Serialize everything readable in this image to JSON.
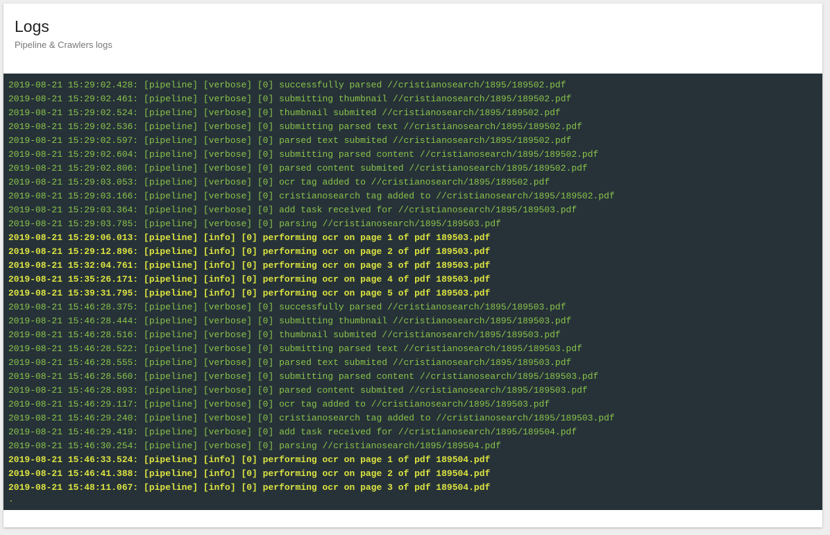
{
  "header": {
    "title": "Logs",
    "subtitle": "Pipeline & Crawlers logs"
  },
  "colors": {
    "console_bg": "#263238",
    "verbose_text": "#8bc34a",
    "info_text": "#dce340"
  },
  "logs": [
    {
      "level": "verbose",
      "text": "2019-08-21 15:29:02.428: [pipeline] [verbose] [0] successfully parsed //cristianosearch/1895/189502.pdf"
    },
    {
      "level": "verbose",
      "text": "2019-08-21 15:29:02.461: [pipeline] [verbose] [0] submitting thumbnail //cristianosearch/1895/189502.pdf"
    },
    {
      "level": "verbose",
      "text": "2019-08-21 15:29:02.524: [pipeline] [verbose] [0] thumbnail submited //cristianosearch/1895/189502.pdf"
    },
    {
      "level": "verbose",
      "text": "2019-08-21 15:29:02.536: [pipeline] [verbose] [0] submitting parsed text //cristianosearch/1895/189502.pdf"
    },
    {
      "level": "verbose",
      "text": "2019-08-21 15:29:02.597: [pipeline] [verbose] [0] parsed text submited //cristianosearch/1895/189502.pdf"
    },
    {
      "level": "verbose",
      "text": "2019-08-21 15:29:02.604: [pipeline] [verbose] [0] submitting parsed content //cristianosearch/1895/189502.pdf"
    },
    {
      "level": "verbose",
      "text": "2019-08-21 15:29:02.806: [pipeline] [verbose] [0] parsed content submited //cristianosearch/1895/189502.pdf"
    },
    {
      "level": "verbose",
      "text": "2019-08-21 15:29:03.053: [pipeline] [verbose] [0] ocr tag added to //cristianosearch/1895/189502.pdf"
    },
    {
      "level": "verbose",
      "text": "2019-08-21 15:29:03.166: [pipeline] [verbose] [0] cristianosearch tag added to //cristianosearch/1895/189502.pdf"
    },
    {
      "level": "verbose",
      "text": "2019-08-21 15:29:03.364: [pipeline] [verbose] [0] add task received for //cristianosearch/1895/189503.pdf"
    },
    {
      "level": "verbose",
      "text": "2019-08-21 15:29:03.785: [pipeline] [verbose] [0] parsing //cristianosearch/1895/189503.pdf"
    },
    {
      "level": "info",
      "text": "2019-08-21 15:29:06.013: [pipeline] [info] [0] performing ocr on page 1 of pdf 189503.pdf"
    },
    {
      "level": "info",
      "text": "2019-08-21 15:29:12.896: [pipeline] [info] [0] performing ocr on page 2 of pdf 189503.pdf"
    },
    {
      "level": "info",
      "text": "2019-08-21 15:32:04.761: [pipeline] [info] [0] performing ocr on page 3 of pdf 189503.pdf"
    },
    {
      "level": "info",
      "text": "2019-08-21 15:35:26.171: [pipeline] [info] [0] performing ocr on page 4 of pdf 189503.pdf"
    },
    {
      "level": "info",
      "text": "2019-08-21 15:39:31.795: [pipeline] [info] [0] performing ocr on page 5 of pdf 189503.pdf"
    },
    {
      "level": "verbose",
      "text": "2019-08-21 15:46:28.375: [pipeline] [verbose] [0] successfully parsed //cristianosearch/1895/189503.pdf"
    },
    {
      "level": "verbose",
      "text": "2019-08-21 15:46:28.444: [pipeline] [verbose] [0] submitting thumbnail //cristianosearch/1895/189503.pdf"
    },
    {
      "level": "verbose",
      "text": "2019-08-21 15:46:28.516: [pipeline] [verbose] [0] thumbnail submited //cristianosearch/1895/189503.pdf"
    },
    {
      "level": "verbose",
      "text": "2019-08-21 15:46:28.522: [pipeline] [verbose] [0] submitting parsed text //cristianosearch/1895/189503.pdf"
    },
    {
      "level": "verbose",
      "text": "2019-08-21 15:46:28.555: [pipeline] [verbose] [0] parsed text submited //cristianosearch/1895/189503.pdf"
    },
    {
      "level": "verbose",
      "text": "2019-08-21 15:46:28.560: [pipeline] [verbose] [0] submitting parsed content //cristianosearch/1895/189503.pdf"
    },
    {
      "level": "verbose",
      "text": "2019-08-21 15:46:28.893: [pipeline] [verbose] [0] parsed content submited //cristianosearch/1895/189503.pdf"
    },
    {
      "level": "verbose",
      "text": "2019-08-21 15:46:29.117: [pipeline] [verbose] [0] ocr tag added to //cristianosearch/1895/189503.pdf"
    },
    {
      "level": "verbose",
      "text": "2019-08-21 15:46:29.240: [pipeline] [verbose] [0] cristianosearch tag added to //cristianosearch/1895/189503.pdf"
    },
    {
      "level": "verbose",
      "text": "2019-08-21 15:46:29.419: [pipeline] [verbose] [0] add task received for //cristianosearch/1895/189504.pdf"
    },
    {
      "level": "verbose",
      "text": "2019-08-21 15:46:30.254: [pipeline] [verbose] [0] parsing //cristianosearch/1895/189504.pdf"
    },
    {
      "level": "info",
      "text": "2019-08-21 15:46:33.524: [pipeline] [info] [0] performing ocr on page 1 of pdf 189504.pdf"
    },
    {
      "level": "info",
      "text": "2019-08-21 15:46:41.388: [pipeline] [info] [0] performing ocr on page 2 of pdf 189504.pdf"
    },
    {
      "level": "info",
      "text": "2019-08-21 15:48:11.067: [pipeline] [info] [0] performing ocr on page 3 of pdf 189504.pdf"
    }
  ],
  "cursor": "."
}
